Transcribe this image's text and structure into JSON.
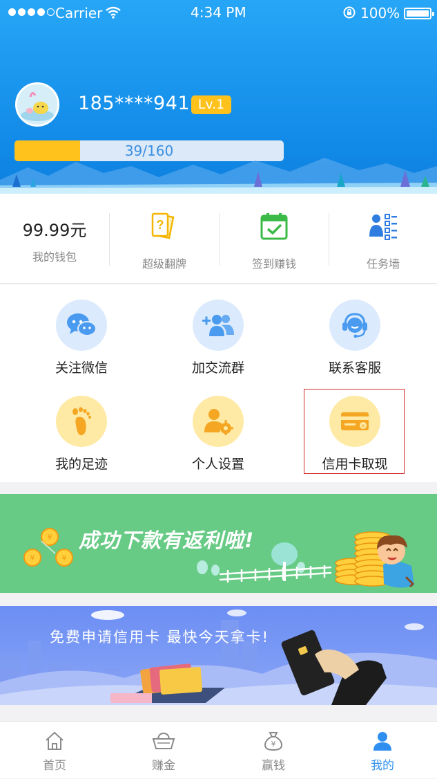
{
  "status_bar": {
    "carrier": "Carrier",
    "time": "4:34 PM",
    "battery": "100%"
  },
  "profile": {
    "phone": "185****9418",
    "level": "Lv.1",
    "progress_text": "39/160",
    "progress_fraction": 0.244
  },
  "stats": {
    "wallet": {
      "value": "99.99元",
      "label": "我的钱包"
    },
    "flip": {
      "label": "超级翻牌"
    },
    "checkin": {
      "label": "签到赚钱"
    },
    "tasks": {
      "label": "任务墙"
    }
  },
  "grid": [
    {
      "label": "关注微信",
      "icon": "wechat-icon"
    },
    {
      "label": "加交流群",
      "icon": "add-group-icon"
    },
    {
      "label": "联系客服",
      "icon": "customer-service-icon"
    },
    {
      "label": "我的足迹",
      "icon": "footprint-icon"
    },
    {
      "label": "个人设置",
      "icon": "user-settings-icon"
    },
    {
      "label": "信用卡取现",
      "icon": "credit-card-icon"
    }
  ],
  "banners": {
    "cashback": "成功下款有返利啦!",
    "credit_card": "免费申请信用卡  最快今天拿卡!"
  },
  "tabs": [
    {
      "label": "首页",
      "icon": "home-icon"
    },
    {
      "label": "赚金",
      "icon": "gold-ingot-icon"
    },
    {
      "label": "赢钱",
      "icon": "money-bag-icon"
    },
    {
      "label": "我的",
      "icon": "profile-icon",
      "active": true
    }
  ],
  "colors": {
    "accent": "#2f8ff0",
    "gold": "#ffc21d",
    "header": "#118ae7",
    "banner_green": "#67cb85",
    "banner_blue": "#6c8ef4"
  }
}
